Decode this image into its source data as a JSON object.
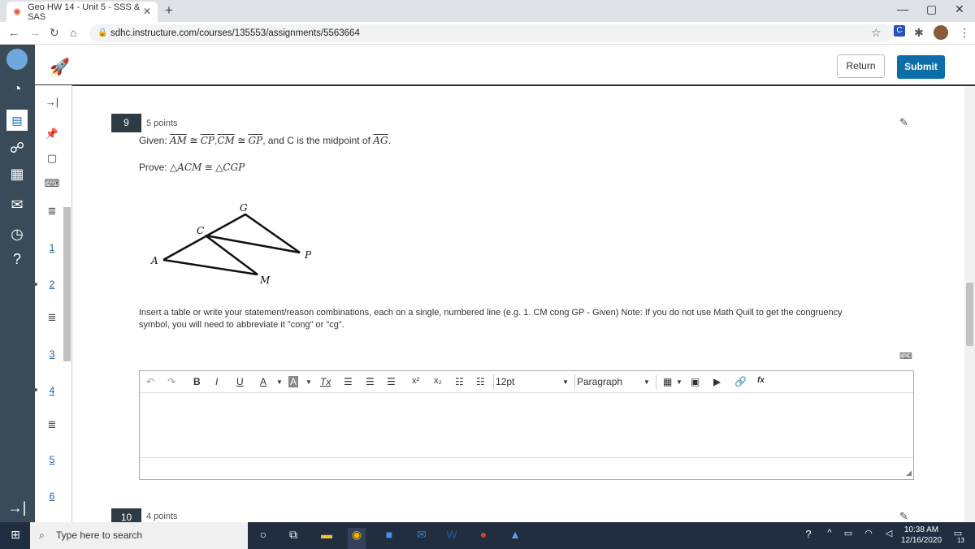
{
  "browser": {
    "tab_title": "Geo HW 14 - Unit 5 - SSS & SAS",
    "tab_close": "✕",
    "new_tab": "+",
    "url": "sdhc.instructure.com/courses/135553/assignments/5563664",
    "window_controls": [
      "—",
      "▢",
      "✕"
    ]
  },
  "header": {
    "return_label": "Return",
    "submit_label": "Submit"
  },
  "question_nav": {
    "items": [
      "1",
      "2",
      "3",
      "4",
      "5",
      "6"
    ]
  },
  "question": {
    "number": "9",
    "points": "5 points",
    "given_prefix": "Given: ",
    "given_seg1": "AM",
    "given_seg2": "CP",
    "given_seg3": "CM",
    "given_seg4": "GP",
    "given_suffix": ", and C is the midpoint of ",
    "given_seg5": "AG",
    "given_end": ".",
    "cong": "≅",
    "comma": ",",
    "prove_prefix": "Prove: ",
    "prove_tri1": "△ACM",
    "prove_tri2": "△CGP",
    "diagram_labels": {
      "A": "A",
      "C": "C",
      "G": "G",
      "P": "P",
      "M": "M"
    },
    "instructions": "Insert a table or write your statement/reason combinations, each on a single, numbered line (e.g. 1. CM cong GP - Given)  Note: If you do not use Math Quill to get the congruency symbol, you will need to abbreviate it \"cong\" or \"cg\"."
  },
  "editor": {
    "font_size": "12pt",
    "paragraph": "Paragraph",
    "bold": "B",
    "italic": "I",
    "underline": "U",
    "text_color": "A",
    "bg_color": "A",
    "clear_format": "Tx",
    "superscript": "x²",
    "subscript": "x₂",
    "math": "fx"
  },
  "next_question": {
    "number": "10",
    "points": "4 points"
  },
  "taskbar": {
    "search_placeholder": "Type here to search",
    "time": "10:38 AM",
    "date": "12/16/2020",
    "notifications": "13"
  },
  "colors": {
    "submit": "#0b6ea8",
    "canvas_nav": "#394b58",
    "question_badge": "#2d3b45",
    "taskbar": "#202e3f"
  }
}
